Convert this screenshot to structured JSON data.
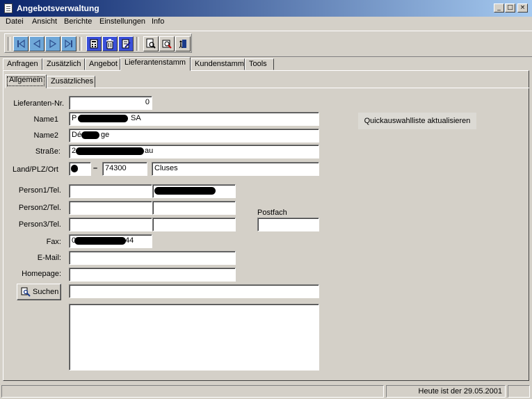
{
  "window": {
    "title": "Angebotsverwaltung",
    "minimize": "_",
    "maximize": "□",
    "close": "×"
  },
  "menu": [
    "Datei",
    "Ansicht",
    "Berichte",
    "Einstellungen",
    "Info"
  ],
  "toolbar": {
    "buttons": [
      "first-record-icon",
      "prev-record-icon",
      "next-record-icon",
      "last-record-icon",
      "calculator-icon",
      "trash-icon",
      "edit-document-icon",
      "print-preview-icon",
      "search-tools-icon",
      "exit-door-icon"
    ]
  },
  "tabs": [
    "Anfragen",
    "Zusätzlich",
    "Angebot",
    "Lieferantenstamm",
    "Kundenstamm",
    "Tools"
  ],
  "active_tab": "Lieferantenstamm",
  "subtabs": [
    "Allgemein",
    "Zusätzliches"
  ],
  "active_subtab": "Allgemein",
  "form": {
    "labels": {
      "supplier_no": "Lieferanten-Nr.",
      "name1": "Name1",
      "name2": "Name2",
      "street": "Straße:",
      "country_zip_city": "Land/PLZ/Ort",
      "person1": "Person1/Tel.",
      "person2": "Person2/Tel.",
      "person3": "Person3/Tel.",
      "postfach": "Postfach",
      "fax": "Fax:",
      "email": "E-Mail:",
      "homepage": "Homepage:"
    },
    "values": {
      "supplier_no": "0",
      "name1_start": "P",
      "name1_end": "SA",
      "name2_start": "Dé",
      "name2_end": "ge",
      "street_start": "2",
      "street_end": "au",
      "country_sep": "–",
      "zip": "74300",
      "city": "Cluses",
      "fax_start": "0",
      "fax_end": "44"
    },
    "quick_button": "Quickauswahlliste aktualisieren",
    "search_button": "Suchen"
  },
  "status": {
    "today": "Heute ist der 29.05.2001"
  }
}
